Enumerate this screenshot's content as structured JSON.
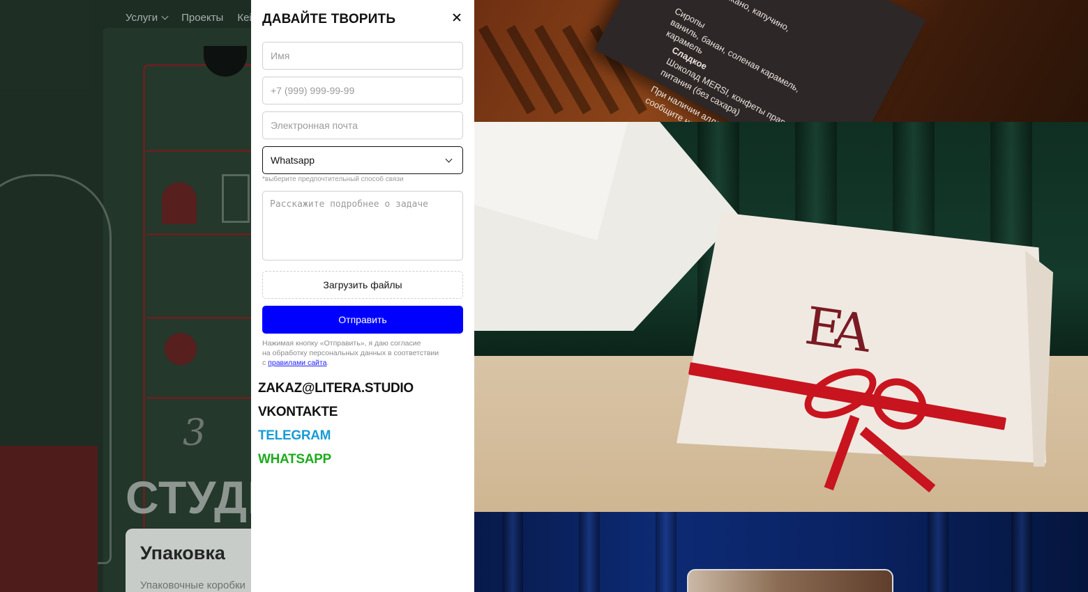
{
  "nav": {
    "items": [
      {
        "label": "Услуги",
        "has_dropdown": true
      },
      {
        "label": "Проекты",
        "has_dropdown": false
      },
      {
        "label": "Кей",
        "has_dropdown": false
      }
    ]
  },
  "background": {
    "hero_text": "СТУДИ",
    "card_title": "Упаковка",
    "card_subtitle": "Упаковочные коробки",
    "box_digit": "3"
  },
  "modal": {
    "title": "Давайте творить",
    "close_icon": "close-icon",
    "fields": {
      "name_placeholder": "Имя",
      "phone_placeholder": "+7 (999) 999-99-99",
      "email_placeholder": "Электронная почта"
    },
    "contact_method": {
      "selected": "Whatsapp",
      "hint": "*выберите предпочтительный способ связи"
    },
    "message_placeholder": "Расскажите подробнее о задаче",
    "upload_label": "Загрузить файлы",
    "submit_label": "Отправить",
    "consent": {
      "text_line1": "Нажимая кнопку «Отправить», я даю согласие",
      "text_line2": "на обработку персональных данных в соответствии",
      "text_prefix": "с ",
      "link_text": "правилами сайта",
      "text_suffix": "."
    },
    "contacts": [
      {
        "label": "ZAKAZ@LITERA.STUDIO",
        "color": "#111111"
      },
      {
        "label": "VKONTAKTE",
        "color": "#111111"
      },
      {
        "label": "TELEGRAM",
        "color": "#179cd6"
      },
      {
        "label": "WHATSAPP",
        "color": "#1dab1d"
      }
    ]
  },
  "images": {
    "menu_card_lines": [
      "Сиропы",
      "ваниль, банан, соленая карамель,",
      "карамель",
      "Сладкое",
      "Шоколад MERSI, конфеты правильного",
      "питания (без сахара)",
      "При наличии аллергии, п",
      "сообщите нам об эт"
    ],
    "menu_card_top": "рикано, капучино,",
    "monogram": "EA"
  },
  "colors": {
    "accent": "#0000ff",
    "telegram": "#179cd6",
    "whatsapp": "#1dab1d",
    "ribbon": "#c8141e"
  }
}
